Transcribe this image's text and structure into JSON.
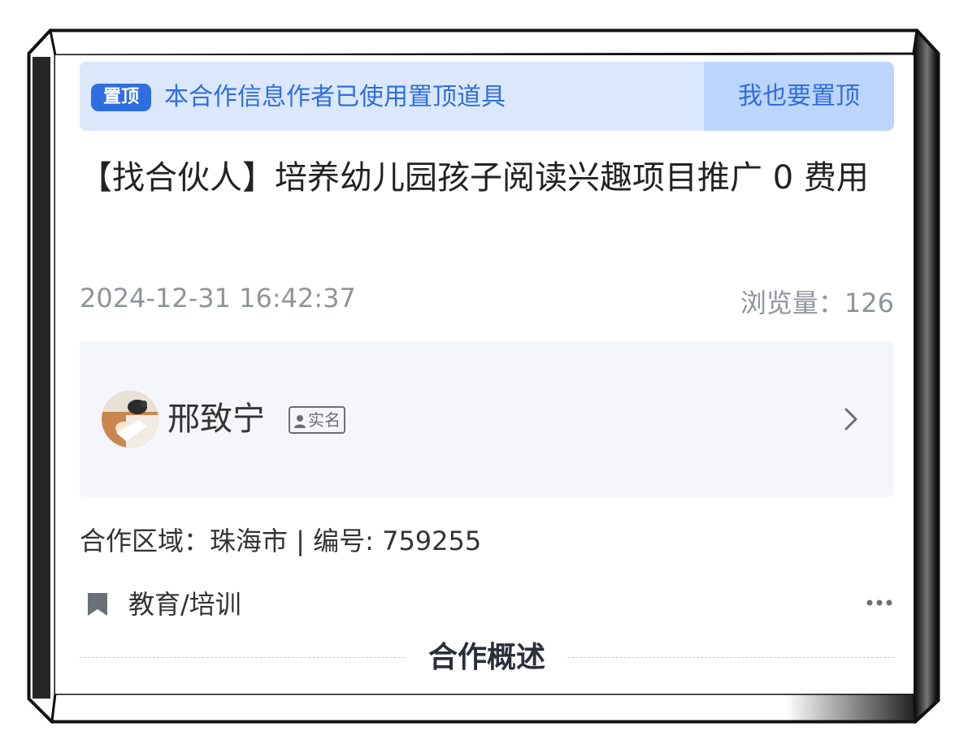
{
  "pin_banner": {
    "badge": "置顶",
    "notice": "本合作信息作者已使用置顶道具",
    "button_label": "我也要置顶"
  },
  "post": {
    "title": "【找合伙人】培养幼儿园孩子阅读兴趣项目推广 0 费用",
    "published_at": "2024-12-31 16:42:37",
    "views_label": "浏览量：126"
  },
  "author": {
    "name": "邢致宁",
    "verified_label": "实名",
    "avatar_icon": "avatar-photo",
    "chevron_icon": "chevron-right-icon"
  },
  "details": {
    "region_line": "合作区域：珠海市 | 编号: 759255",
    "category": "教育/培训",
    "category_icon": "bookmark-icon",
    "more_icon": "more-dots-icon"
  },
  "section": {
    "title": "合作概述"
  },
  "colors": {
    "accent": "#2f6ee0",
    "banner_bg": "#dbe8fb",
    "banner_button_bg": "#bcd5fa",
    "card_bg": "#f5f6f9",
    "muted_text": "#8f949c"
  }
}
